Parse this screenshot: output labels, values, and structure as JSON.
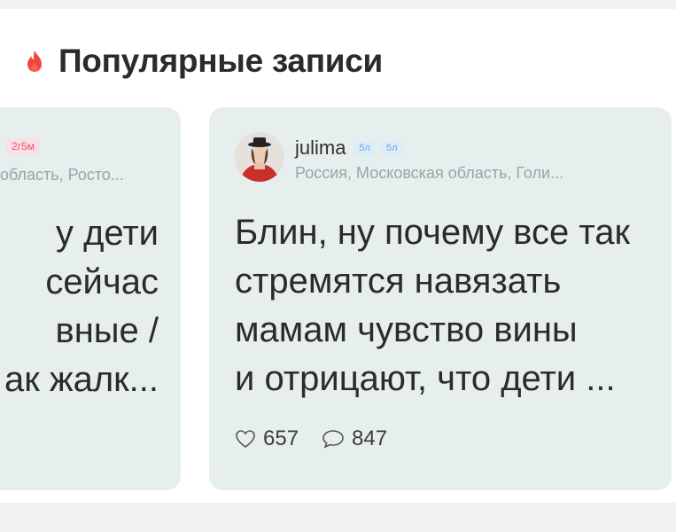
{
  "section": {
    "title": "Популярные записи",
    "icon": "flame-icon",
    "icon_color": "#f2453d"
  },
  "cards": [
    {
      "age_badge": "2г5м",
      "location": "область, Росто...",
      "text_lines": [
        "у дети",
        "сейчас",
        "вные /",
        "ак жалк..."
      ]
    },
    {
      "username": "julima",
      "badges": [
        "5л",
        "5л"
      ],
      "location": "Россия, Московская область, Голи...",
      "text_lines": [
        "Блин, ну почему все так",
        "стремятся навязать",
        "мамам чувство вины",
        "и отрицают, что дети ..."
      ],
      "likes": "657",
      "comments": "847"
    }
  ],
  "colors": {
    "card_bg": "#e7efee",
    "accent_red": "#f2453d",
    "muted_text": "#9aa3a6"
  }
}
